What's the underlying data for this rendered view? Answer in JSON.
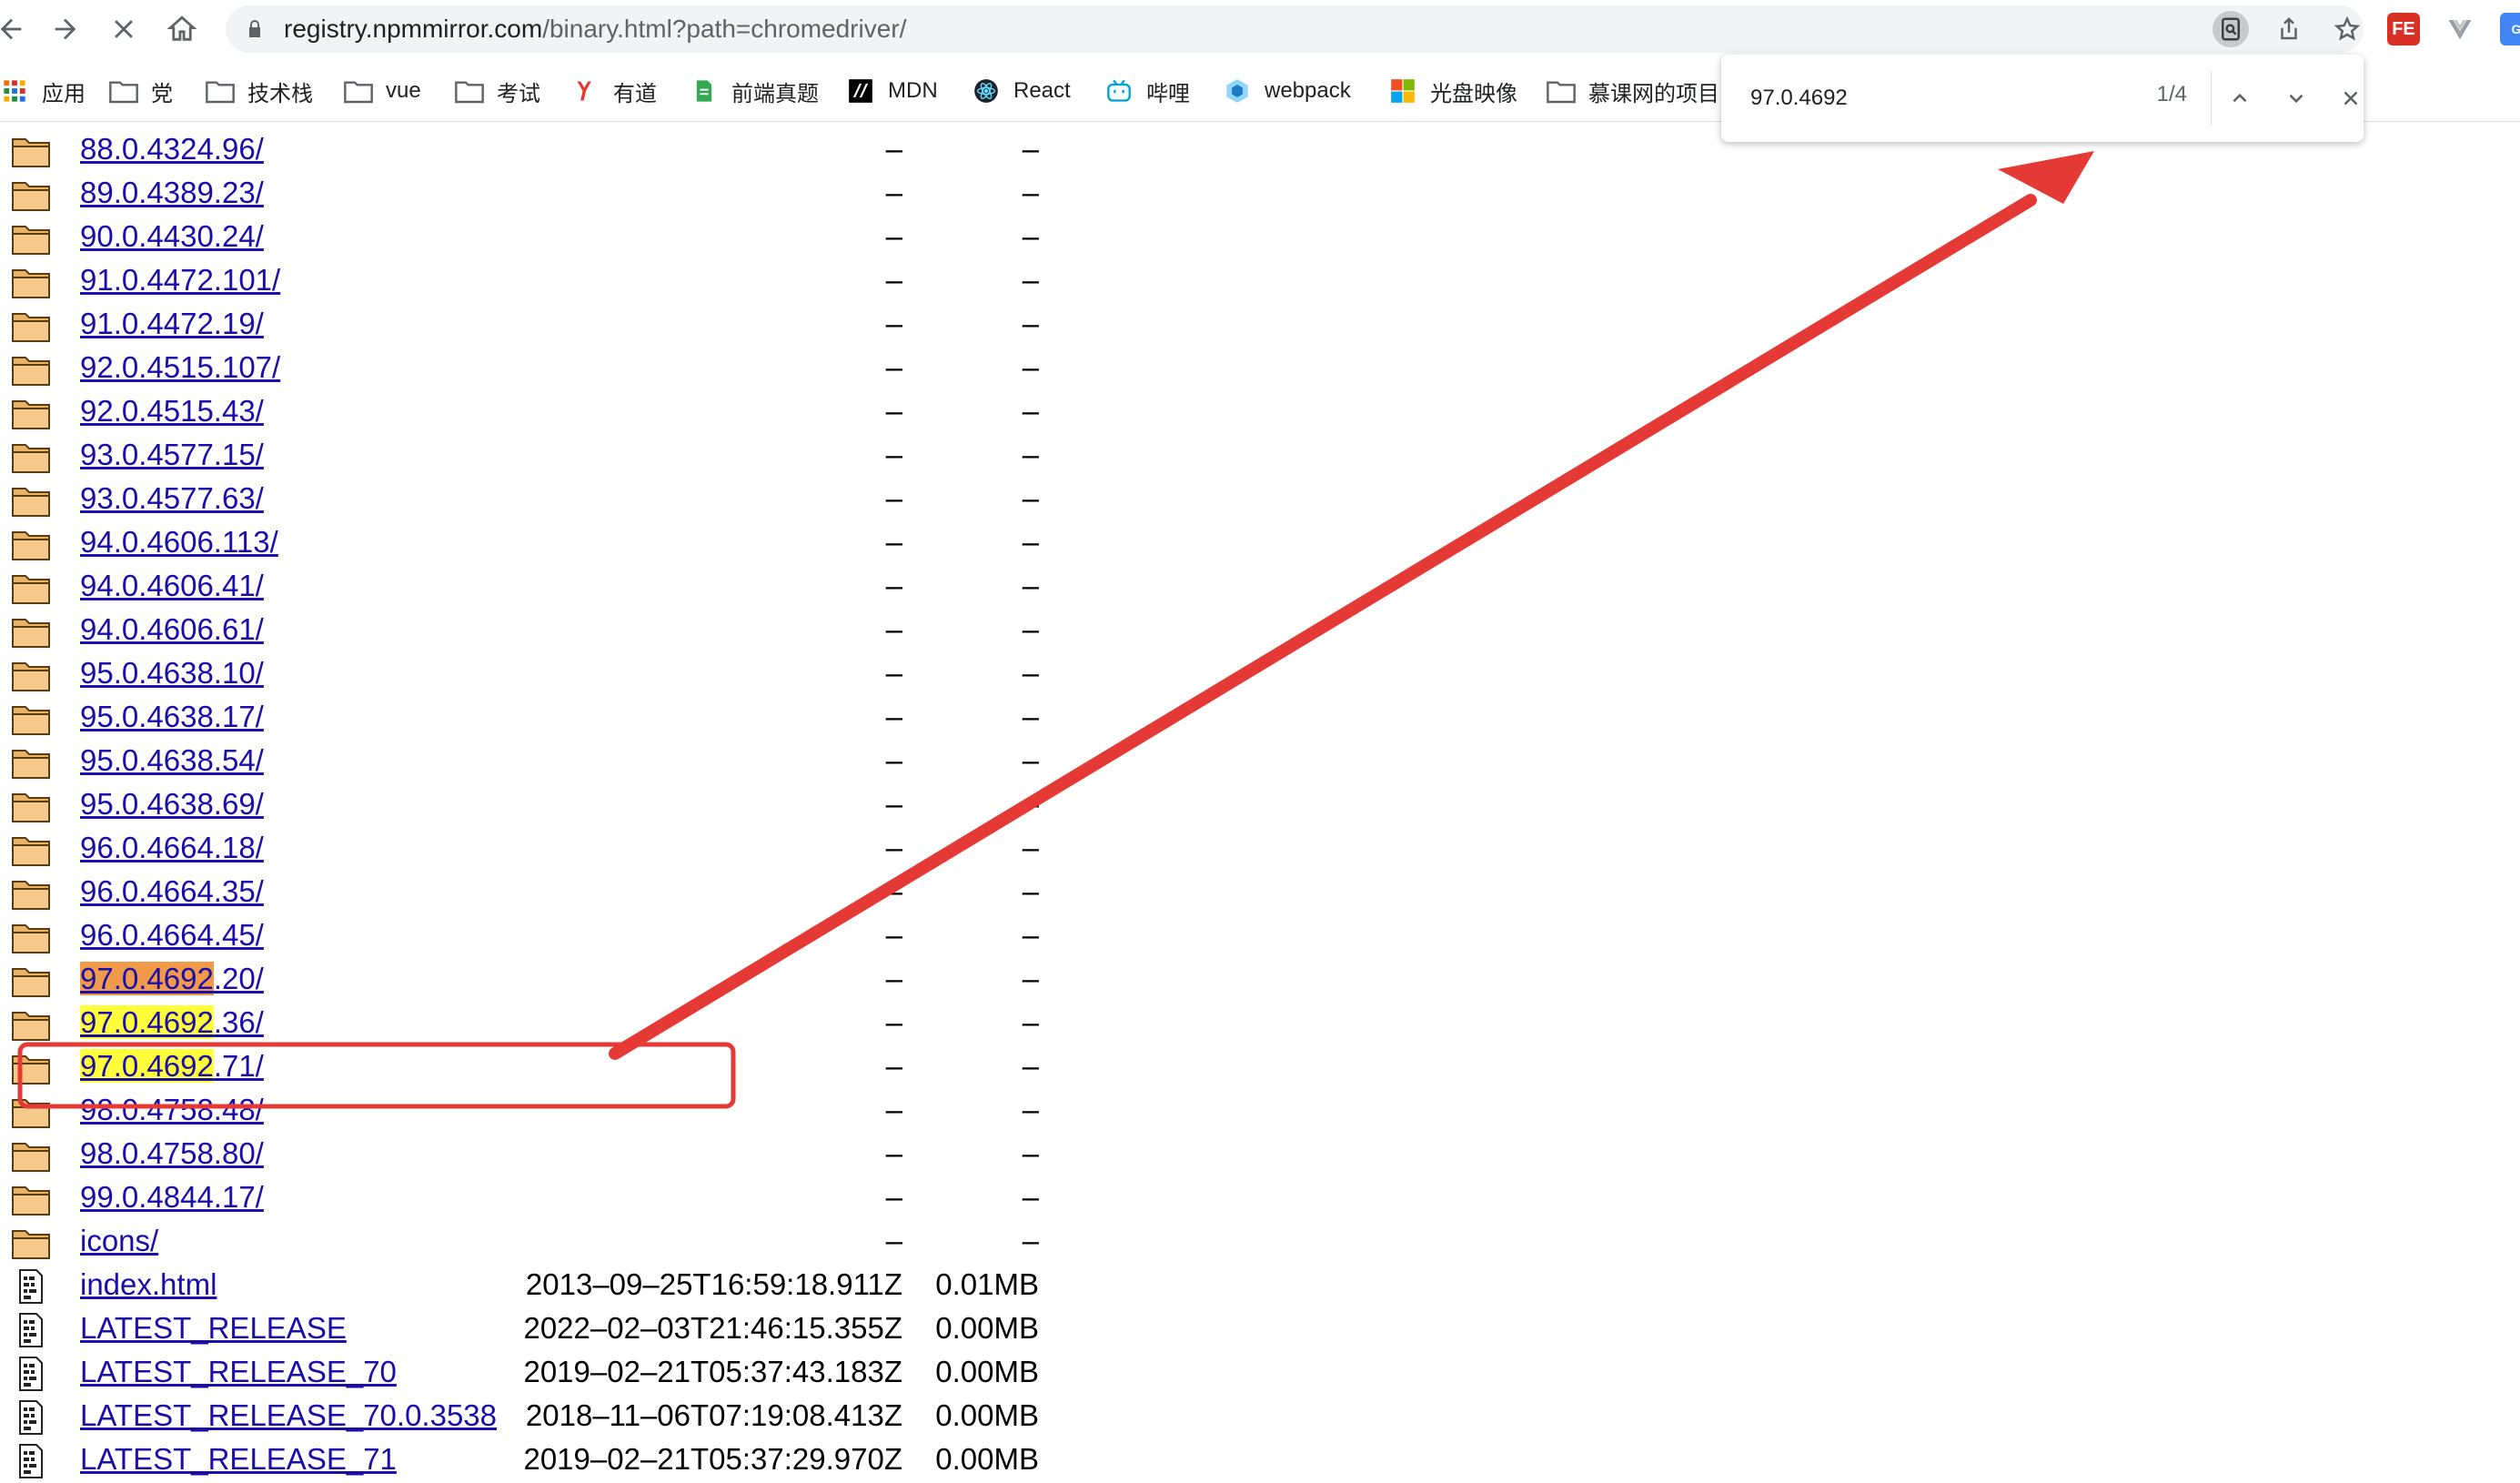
{
  "browser": {
    "url_host": "registry.npmmirror.com",
    "url_path": "/binary.html?path=chromedriver/"
  },
  "bookmarks": [
    {
      "label": "应用",
      "icon": "apps-grid-icon"
    },
    {
      "label": "党",
      "icon": "folder-icon"
    },
    {
      "label": "技术栈",
      "icon": "folder-icon"
    },
    {
      "label": "vue",
      "icon": "folder-icon"
    },
    {
      "label": "考试",
      "icon": "folder-icon"
    },
    {
      "label": "有道",
      "icon": "youdao-icon"
    },
    {
      "label": "前端真题",
      "icon": "document-icon"
    },
    {
      "label": "MDN",
      "icon": "mdn-icon"
    },
    {
      "label": "React",
      "icon": "react-icon"
    },
    {
      "label": "哔哩",
      "icon": "bilibili-icon"
    },
    {
      "label": "webpack",
      "icon": "webpack-icon"
    },
    {
      "label": "光盘映像",
      "icon": "windows-icon"
    },
    {
      "label": "慕课网的项目",
      "icon": "folder-icon"
    }
  ],
  "find": {
    "query": "97.0.4692",
    "count": "1/4"
  },
  "listing": [
    {
      "name": "88.0.4324.96/",
      "type": "dir",
      "date": "–",
      "size": "–"
    },
    {
      "name": "89.0.4389.23/",
      "type": "dir",
      "date": "–",
      "size": "–"
    },
    {
      "name": "90.0.4430.24/",
      "type": "dir",
      "date": "–",
      "size": "–"
    },
    {
      "name": "91.0.4472.101/",
      "type": "dir",
      "date": "–",
      "size": "–"
    },
    {
      "name": "91.0.4472.19/",
      "type": "dir",
      "date": "–",
      "size": "–"
    },
    {
      "name": "92.0.4515.107/",
      "type": "dir",
      "date": "–",
      "size": "–"
    },
    {
      "name": "92.0.4515.43/",
      "type": "dir",
      "date": "–",
      "size": "–"
    },
    {
      "name": "93.0.4577.15/",
      "type": "dir",
      "date": "–",
      "size": "–"
    },
    {
      "name": "93.0.4577.63/",
      "type": "dir",
      "date": "–",
      "size": "–"
    },
    {
      "name": "94.0.4606.113/",
      "type": "dir",
      "date": "–",
      "size": "–"
    },
    {
      "name": "94.0.4606.41/",
      "type": "dir",
      "date": "–",
      "size": "–"
    },
    {
      "name": "94.0.4606.61/",
      "type": "dir",
      "date": "–",
      "size": "–"
    },
    {
      "name": "95.0.4638.10/",
      "type": "dir",
      "date": "–",
      "size": "–"
    },
    {
      "name": "95.0.4638.17/",
      "type": "dir",
      "date": "–",
      "size": "–"
    },
    {
      "name": "95.0.4638.54/",
      "type": "dir",
      "date": "–",
      "size": "–"
    },
    {
      "name": "95.0.4638.69/",
      "type": "dir",
      "date": "–",
      "size": "–"
    },
    {
      "name": "96.0.4664.18/",
      "type": "dir",
      "date": "–",
      "size": "–"
    },
    {
      "name": "96.0.4664.35/",
      "type": "dir",
      "date": "–",
      "size": "–"
    },
    {
      "name": "96.0.4664.45/",
      "type": "dir",
      "date": "–",
      "size": "–"
    },
    {
      "name": "97.0.4692.20/",
      "type": "dir",
      "date": "–",
      "size": "–",
      "match": "current"
    },
    {
      "name": "97.0.4692.36/",
      "type": "dir",
      "date": "–",
      "size": "–",
      "match": "other"
    },
    {
      "name": "97.0.4692.71/",
      "type": "dir",
      "date": "–",
      "size": "–",
      "match": "other"
    },
    {
      "name": "98.0.4758.48/",
      "type": "dir",
      "date": "–",
      "size": "–"
    },
    {
      "name": "98.0.4758.80/",
      "type": "dir",
      "date": "–",
      "size": "–"
    },
    {
      "name": "99.0.4844.17/",
      "type": "dir",
      "date": "–",
      "size": "–"
    },
    {
      "name": "icons/",
      "type": "dir",
      "date": "–",
      "size": "–"
    },
    {
      "name": "index.html",
      "type": "file",
      "date": "2013–09–25T16:59:18.911Z",
      "size": "0.01MB"
    },
    {
      "name": "LATEST_RELEASE",
      "type": "file",
      "date": "2022–02–03T21:46:15.355Z",
      "size": "0.00MB"
    },
    {
      "name": "LATEST_RELEASE_70",
      "type": "file",
      "date": "2019–02–21T05:37:43.183Z",
      "size": "0.00MB"
    },
    {
      "name": "LATEST_RELEASE_70.0.3538",
      "type": "file",
      "date": "2018–11–06T07:19:08.413Z",
      "size": "0.00MB"
    },
    {
      "name": "LATEST_RELEASE_71",
      "type": "file",
      "date": "2019–02–21T05:37:29.970Z",
      "size": "0.00MB"
    }
  ],
  "colors": {
    "link": "#1a0dab",
    "highlight_current": "#f09a4a",
    "highlight_other": "#ffff3a",
    "annotation": "#e53935"
  }
}
